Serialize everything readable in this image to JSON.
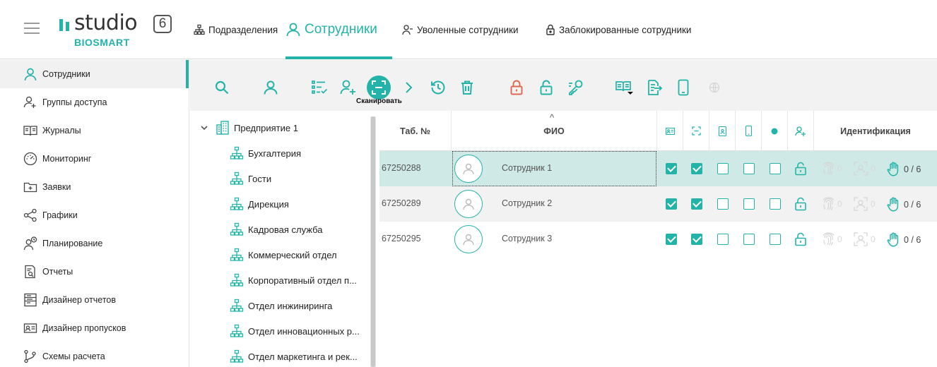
{
  "header": {
    "logo_word": "studio",
    "logo_version": "6",
    "logo_sub": "BIOSMART",
    "tabs": [
      {
        "label": "Подразделения",
        "icon": "org-structure-icon"
      },
      {
        "label": "Сотрудники",
        "icon": "user-icon",
        "active": true
      },
      {
        "label": "Уволенные сотрудники",
        "icon": "user-minus-icon"
      },
      {
        "label": "Заблокированные сотрудники",
        "icon": "lock-icon"
      }
    ]
  },
  "sidebar": {
    "items": [
      {
        "label": "Сотрудники",
        "icon": "user-icon",
        "active": true
      },
      {
        "label": "Группы доступа",
        "icon": "users-add-icon"
      },
      {
        "label": "Журналы",
        "icon": "book-icon"
      },
      {
        "label": "Мониторинг",
        "icon": "gauge-icon"
      },
      {
        "label": "Заявки",
        "icon": "folder-plus-icon"
      },
      {
        "label": "Графики",
        "icon": "share-icon"
      },
      {
        "label": "Планирование",
        "icon": "user-clock-icon"
      },
      {
        "label": "Отчеты",
        "icon": "report-icon"
      },
      {
        "label": "Дизайнер отчетов",
        "icon": "report-designer-icon"
      },
      {
        "label": "Дизайнер пропусков",
        "icon": "id-card-icon"
      },
      {
        "label": "Схемы расчета",
        "icon": "branch-icon"
      }
    ]
  },
  "toolbar": {
    "scan_label": "Сканировать",
    "buttons": [
      "search-icon",
      "user-icon",
      "checklist-icon",
      "user-add-icon",
      "scan-icon",
      "chevron-right-icon",
      "history-icon",
      "trash-icon",
      "lock-red-icon",
      "unlock-icon",
      "key-icon",
      "book-dropdown-icon",
      "export-icon",
      "phone-icon",
      "globe-icon"
    ]
  },
  "tree": {
    "root": "Предприятие 1",
    "nodes": [
      "Бухгалтерия",
      "Гости",
      "Дирекция",
      "Кадровая служба",
      "Коммерческий отдел",
      "Корпоративный отдел п...",
      "Отдел инжиниринга",
      "Отдел инновационных р...",
      "Отдел маркетинга и рек..."
    ]
  },
  "table": {
    "headers": {
      "tab_no": "Таб. №",
      "fio": "ФИО",
      "ident": "Идентификация"
    },
    "sort_indicator": "^",
    "rows": [
      {
        "tab_no": "67250288",
        "name": "Сотрудник 1",
        "checks": [
          true,
          true,
          false,
          false,
          false
        ],
        "finger": "0",
        "face": "0",
        "palm": "0 / 6",
        "selected": true
      },
      {
        "tab_no": "67250289",
        "name": "Сотрудник 2",
        "checks": [
          true,
          true,
          false,
          false,
          false
        ],
        "finger": "0",
        "face": "0",
        "palm": "0 / 6"
      },
      {
        "tab_no": "67250295",
        "name": "Сотрудник 3",
        "checks": [
          true,
          true,
          false,
          false,
          false
        ],
        "finger": "0",
        "face": "0",
        "palm": "0 / 6"
      }
    ]
  },
  "colors": {
    "accent": "#23b3a8",
    "selected_row": "#cfe9e6",
    "alt_row": "#f2f2f2",
    "danger": "#e0674f"
  }
}
